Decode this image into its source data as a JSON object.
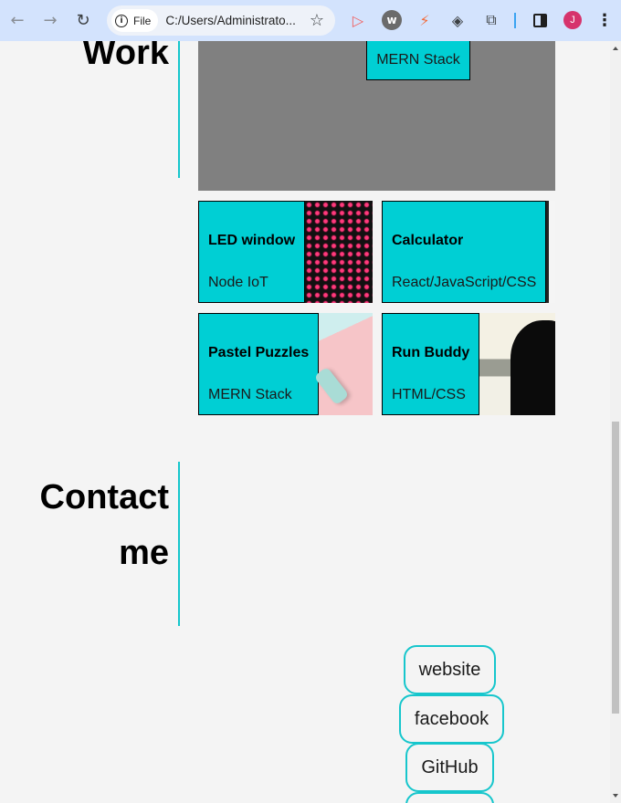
{
  "browser": {
    "back_icon": "←",
    "forward_icon": "→",
    "reload_icon": "↻",
    "file_label": "File",
    "url": "C:/Users/Administrato...",
    "star_icon": "☆",
    "profile_initial": "J",
    "menu_icon": "⋮",
    "extensions": [
      "▷",
      "w",
      "⚡",
      "◈",
      "⧉"
    ],
    "accent_color": "#d3e3fd"
  },
  "work": {
    "heading": "Work",
    "hero_tech": "MERN Stack",
    "projects": [
      {
        "title": "LED window",
        "tech": "Node IoT"
      },
      {
        "title": "Calculator",
        "tech": "React/JavaScript/CSS"
      },
      {
        "title": "Pastel Puzzles",
        "tech": "MERN Stack"
      },
      {
        "title": "Run Buddy",
        "tech": "HTML/CSS"
      }
    ]
  },
  "contact": {
    "heading_line1": "Contact",
    "heading_line2": "me",
    "links": [
      {
        "label": "website"
      },
      {
        "label": "facebook"
      },
      {
        "label": "GitHub"
      }
    ]
  },
  "colors": {
    "accent": "#00cfd4",
    "border": "#16c6cc",
    "background": "#f4f4f4"
  }
}
